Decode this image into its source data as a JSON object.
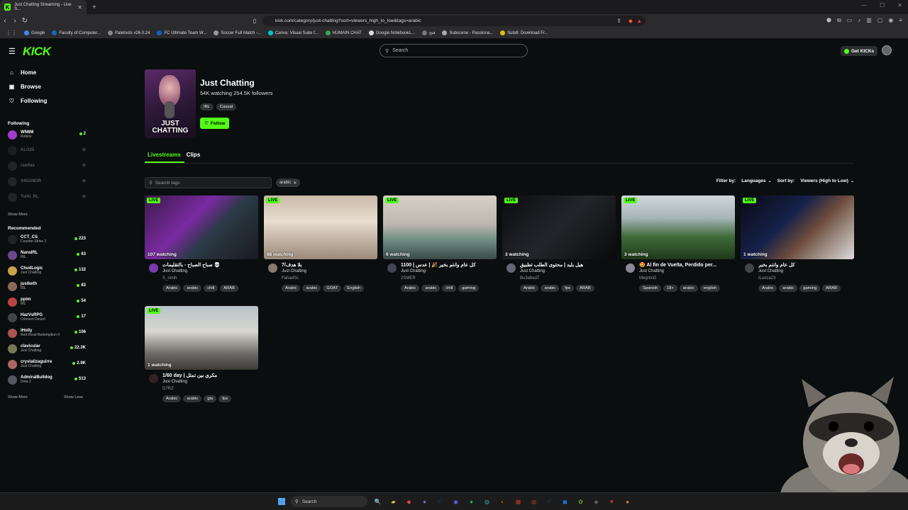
{
  "browser": {
    "tab_title": "Just Chatting Streaming - Live S...",
    "url": "kick.com/category/just-chatting?sort=viewers_high_to_low&tags=arabic",
    "bookmarks": [
      {
        "label": "Google",
        "color": "#4285f4"
      },
      {
        "label": "Faculty of Computer...",
        "color": "#1565c0"
      },
      {
        "label": "Paletools v26.0.24",
        "color": "#888888"
      },
      {
        "label": "FC Ultimate Team W...",
        "color": "#0b63c5"
      },
      {
        "label": "Soccer Full Match -...",
        "color": "#999999"
      },
      {
        "label": "Canva: Visual Suite f...",
        "color": "#00c4cc"
      },
      {
        "label": "HUMAIN CHAT",
        "color": "#3aa35c"
      },
      {
        "label": "Google NotebookL...",
        "color": "#dddddd"
      },
      {
        "label": "فتح",
        "color": "#777777"
      },
      {
        "label": "Subscene - Passiona...",
        "color": "#aaaaaa"
      },
      {
        "label": "Subdl: Download Fr...",
        "color": "#e3c000"
      }
    ]
  },
  "header": {
    "logo": "KICK",
    "search_placeholder": "Search",
    "get_kicks": "Get KICKs"
  },
  "sidebar": {
    "nav": [
      {
        "label": "Home",
        "icon": "⌂"
      },
      {
        "label": "Browse",
        "icon": "▣"
      },
      {
        "label": "Following",
        "icon": "♡"
      }
    ],
    "following_title": "Following",
    "following": [
      {
        "name": "WN6M",
        "category": "Roblox",
        "viewers": "2",
        "online": true,
        "color": "#a23cc9"
      },
      {
        "name": "KLO25",
        "category": "",
        "viewers": "",
        "online": false,
        "color": "#444"
      },
      {
        "name": "ramfaa",
        "category": "",
        "viewers": "",
        "online": false,
        "color": "#555"
      },
      {
        "name": "S4GAM3R",
        "category": "",
        "viewers": "",
        "online": false,
        "color": "#555"
      },
      {
        "name": "Turki_RL",
        "category": "",
        "viewers": "",
        "online": false,
        "color": "#555"
      }
    ],
    "show_more": "Show More",
    "recommended_title": "Recommended",
    "recommended": [
      {
        "name": "CCT_CS",
        "category": "Counter-Strike 2",
        "viewers": "223",
        "color": "#222"
      },
      {
        "name": "NanaIRL",
        "category": "IRL",
        "viewers": "63",
        "color": "#6a4a8a"
      },
      {
        "name": "ChudLogic",
        "category": "Just Chatting",
        "viewers": "132",
        "color": "#c9a24a"
      },
      {
        "name": "justketh",
        "category": "IRL",
        "viewers": "83",
        "color": "#8a6a5a"
      },
      {
        "name": "ppim",
        "category": "IRL",
        "viewers": "54",
        "color": "#b44"
      },
      {
        "name": "HazVsRPG",
        "category": "Crimson Desert",
        "viewers": "17",
        "color": "#444"
      },
      {
        "name": "iHolly",
        "category": "Red Dead Redemption II",
        "viewers": "106",
        "color": "#a55"
      },
      {
        "name": "clavicular",
        "category": "Just Chatting",
        "viewers": "22.3K",
        "color": "#775"
      },
      {
        "name": "crystalizaguirre",
        "category": "Just Chatting",
        "viewers": "2.9K",
        "color": "#a66"
      },
      {
        "name": "AdmiralBulldog",
        "category": "Dota 2",
        "viewers": "513",
        "color": "#556"
      }
    ],
    "show_more_2": "Show More",
    "show_less": "Show Less"
  },
  "category": {
    "image_text": "JUST CHATTING",
    "title": "Just Chatting",
    "stats": "54K watching  254.5K followers",
    "tags": [
      "IRL",
      "Casual"
    ],
    "follow_label": "Follow"
  },
  "tabs": [
    "Livestreams",
    "Clips"
  ],
  "filters": {
    "tag_search_placeholder": "Search tags",
    "active_tag": "arabic",
    "filter_by_label": "Filter by:",
    "languages": "Languages",
    "sort_by_label": "Sort by:",
    "sort_value": "Viewers (High to Low)"
  },
  "streams": [
    {
      "watching": "107 watching",
      "title": "صباح الصباح - بالتقليمات 💀",
      "category": "Just Chatting",
      "user": "S_nmih",
      "tags": [
        "Arabic",
        "arabic",
        "chill",
        "ARAB"
      ],
      "avatar": "#7a3ab0"
    },
    {
      "watching": "88 watching",
      "title": "بلا هدف/7",
      "category": "Just Chatting",
      "user": "FahadSc",
      "tags": [
        "Arabic",
        "arabic",
        "GOAT",
        "English"
      ],
      "avatar": "#8a7a6a"
    },
    {
      "watching": "6 watching",
      "title": "كل عام وانتم بخير 🎉 | عدس | 1100",
      "category": "Just Chatting",
      "user": "2SMER",
      "tags": [
        "Arabic",
        "arabic",
        "chill",
        "gaming"
      ],
      "avatar": "#445"
    },
    {
      "watching": "3 watching",
      "title": "هيل بليد | محتوى الطلب تطبيق",
      "category": "Just Chatting",
      "user": "Bu3abed7",
      "tags": [
        "Arabic",
        "arabic",
        "fps",
        "ARAB"
      ],
      "avatar": "#667"
    },
    {
      "watching": "3 watching",
      "title": "🤩 Al fin de Vuelta, Perdido per...",
      "category": "Just Chatting",
      "user": "MegriniG",
      "tags": [
        "Spanish",
        "18+",
        "arabic",
        "english"
      ],
      "avatar": "#889"
    },
    {
      "watching": "1 watching",
      "title": "كل عام وانتم بخير",
      "category": "Just Chatting",
      "user": "ILucca23",
      "tags": [
        "Arabic",
        "arabic",
        "gaming",
        "ARAB"
      ],
      "avatar": "#444"
    },
    {
      "watching": "1 watching",
      "title": "1/60 day | مكري بين تمثل",
      "category": "Just Chatting",
      "user": "D7RZ",
      "tags": [
        "Arabic",
        "arabic",
        "gta",
        "fps"
      ],
      "avatar": "#322"
    }
  ],
  "live_label": "LIVE",
  "taskbar": {
    "search": "Search",
    "icons": [
      {
        "glyph": "🔍",
        "color": "#f0a000"
      },
      {
        "glyph": "▰",
        "color": "#f2c14e"
      },
      {
        "glyph": "◆",
        "color": "#e0453a"
      },
      {
        "glyph": "●",
        "color": "#7b68ee"
      },
      {
        "glyph": "◤",
        "color": "#1b2838"
      },
      {
        "glyph": "◉",
        "color": "#5865f2"
      },
      {
        "glyph": "●",
        "color": "#1db954"
      },
      {
        "glyph": "◍",
        "color": "#2aa"
      },
      {
        "glyph": "◐",
        "color": "#d35400"
      },
      {
        "glyph": "▦",
        "color": "#c0392b"
      },
      {
        "glyph": "◎",
        "color": "#e74c3c"
      },
      {
        "glyph": "◤",
        "color": "#1b2838"
      },
      {
        "glyph": "◼",
        "color": "#1c6dd0"
      },
      {
        "glyph": "✿",
        "color": "#6a3"
      },
      {
        "glyph": "◈",
        "color": "#777"
      },
      {
        "glyph": "▼",
        "color": "#c0392b"
      },
      {
        "glyph": "●",
        "color": "#e67e22"
      }
    ]
  }
}
